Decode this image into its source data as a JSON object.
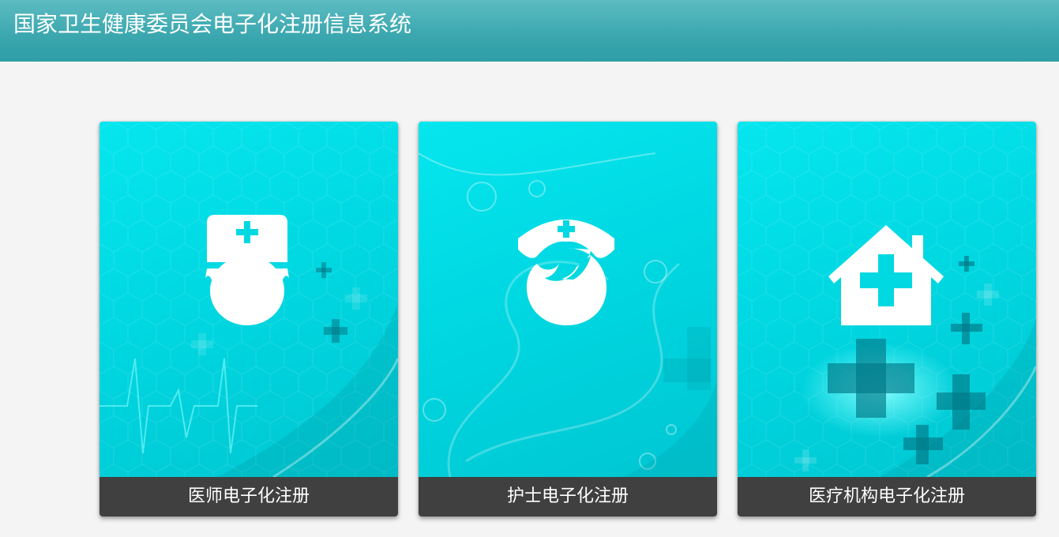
{
  "header": {
    "title": "国家卫生健康委员会电子化注册信息系统"
  },
  "cards": [
    {
      "label": "医师电子化注册",
      "icon": "doctor-icon"
    },
    {
      "label": "护士电子化注册",
      "icon": "nurse-icon"
    },
    {
      "label": "医疗机构电子化注册",
      "icon": "hospital-icon"
    }
  ],
  "colors": {
    "header": "#3aa6ae",
    "card_background": "#00d8e2",
    "label_background": "#404040",
    "page_background": "#f4f4f4"
  }
}
